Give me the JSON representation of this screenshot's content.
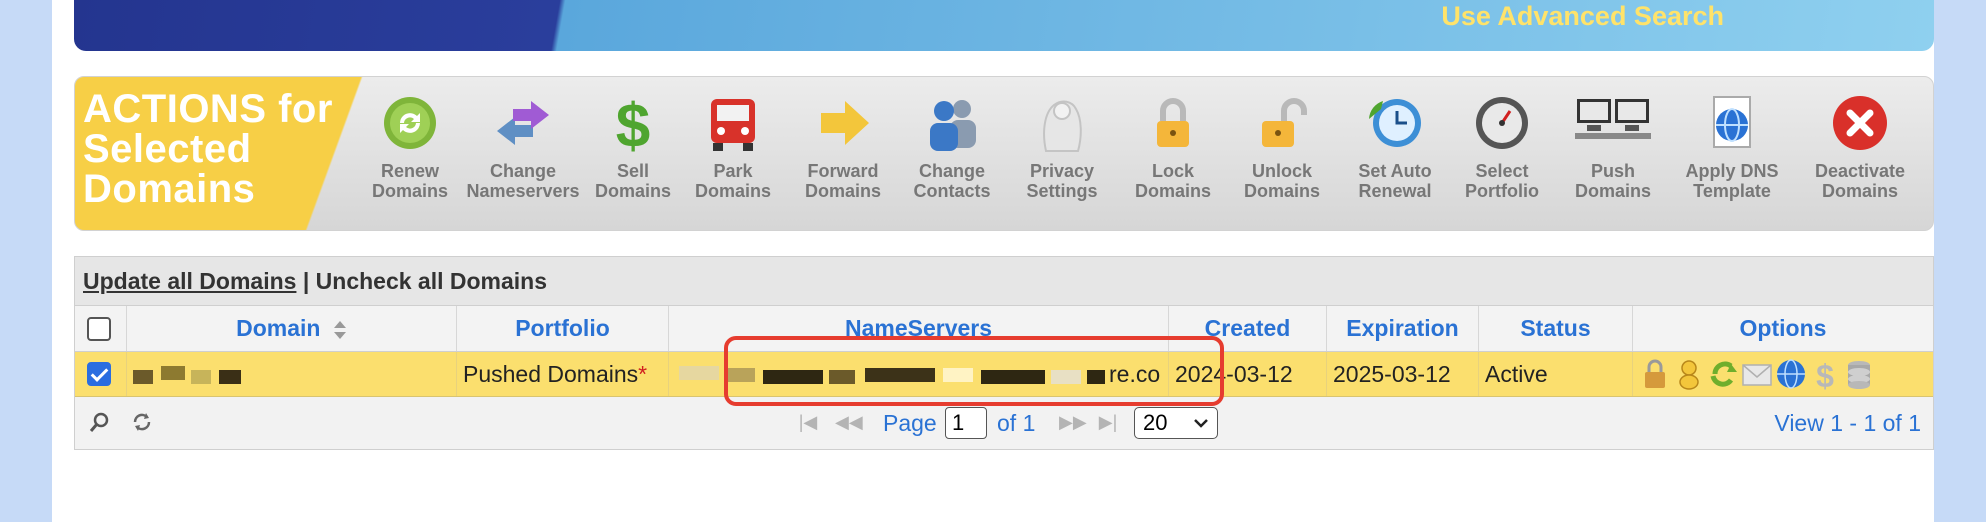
{
  "banner": {
    "link_label": "Use Advanced Search"
  },
  "actions": {
    "title": "ACTIONS for Selected Domains",
    "items": [
      {
        "label": "Renew\nDomains",
        "icon": "renew-icon"
      },
      {
        "label": "Change\nNameservers",
        "icon": "change-nameservers-icon"
      },
      {
        "label": "Sell\nDomains",
        "icon": "dollar-icon"
      },
      {
        "label": "Park\nDomains",
        "icon": "car-icon"
      },
      {
        "label": "Forward\nDomains",
        "icon": "arrow-right-icon"
      },
      {
        "label": "Change\nContacts",
        "icon": "contacts-icon"
      },
      {
        "label": "Privacy\nSettings",
        "icon": "privacy-icon"
      },
      {
        "label": "Lock\nDomains",
        "icon": "lock-icon"
      },
      {
        "label": "Unlock\nDomains",
        "icon": "unlock-icon"
      },
      {
        "label": "Set Auto\nRenewal",
        "icon": "clock-icon"
      },
      {
        "label": "Select\nPortfolio",
        "icon": "gauge-icon"
      },
      {
        "label": "Push\nDomains",
        "icon": "computers-icon"
      },
      {
        "label": "Apply DNS\nTemplate",
        "icon": "globe-document-icon"
      },
      {
        "label": "Deactivate\nDomains",
        "icon": "close-circle-icon"
      }
    ]
  },
  "grid": {
    "update_all": "Update all Domains",
    "separator": " | ",
    "uncheck_all": "Uncheck all Domains",
    "columns": [
      "Domain",
      "Portfolio",
      "NameServers",
      "Created",
      "Expiration",
      "Status",
      "Options"
    ],
    "rows": [
      {
        "portfolio": "Pushed Domains",
        "required_mark": "*",
        "ns_tail": "re.co",
        "created": "2024-03-12",
        "expiration": "2025-03-12",
        "status": "Active"
      }
    ],
    "option_icons": [
      "lock-icon",
      "person-icon",
      "refresh-icon",
      "mail-icon",
      "globe-icon",
      "dollar-icon",
      "database-icon"
    ]
  },
  "pager": {
    "page_label": "Page",
    "page_value": "1",
    "of_label": "of 1",
    "page_size": "20",
    "view_label": "View 1 - 1 of 1"
  },
  "colors": {
    "accent_yellow": "#f7cf46",
    "link_blue": "#2a72d4",
    "highlight_red": "#e63c2f",
    "row_highlight": "#fbdf6e"
  }
}
